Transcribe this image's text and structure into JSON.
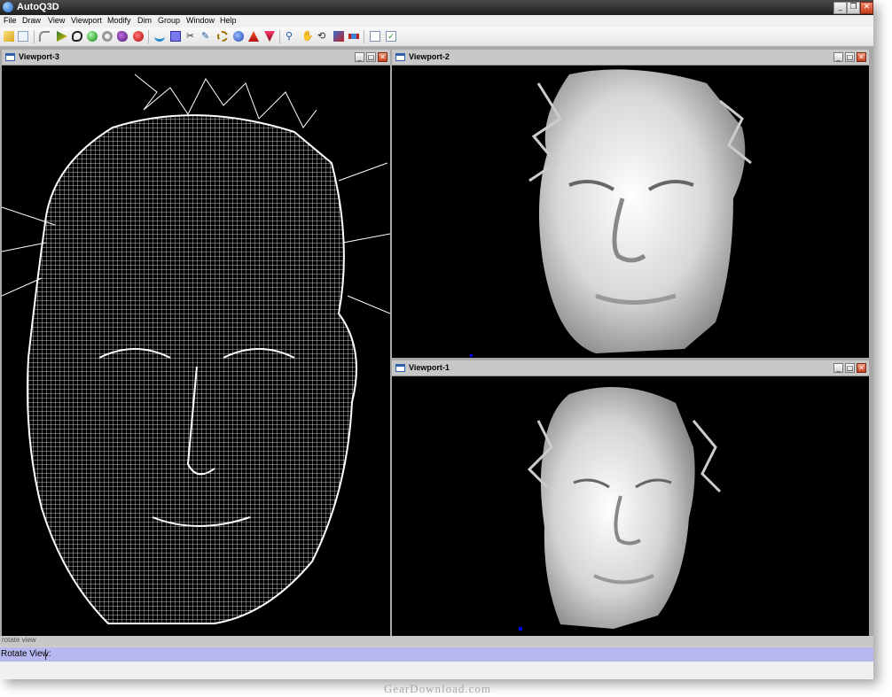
{
  "window": {
    "title": "AutoQ3D"
  },
  "title_buttons": {
    "minimize": "_",
    "restore": "❐",
    "close": "✕"
  },
  "menu": [
    "File",
    "Draw",
    "View",
    "Viewport",
    "Modify",
    "Dim",
    "Group",
    "Window",
    "Help"
  ],
  "toolbar_icons": [
    "new-file-icon",
    "save-icon",
    "curve-icon",
    "pointer-icon",
    "lasso-icon",
    "sphere-green-icon",
    "torus-icon",
    "blob-purple-icon",
    "apple-red-icon",
    "wave-icon",
    "square-blue-icon",
    "scissors-icon",
    "pencil-icon",
    "rotate-chain-icon",
    "fire-icon",
    "sphere-blue-icon",
    "fire2-icon",
    "zoom-icon",
    "hand-pan-icon",
    "rotate-view-icon",
    "cube-icon",
    "bone-icon",
    "document-icon",
    "check-document-icon"
  ],
  "viewports": [
    {
      "name": "Viewport-3",
      "mode": "wireframe"
    },
    {
      "name": "Viewport-2",
      "mode": "shaded"
    },
    {
      "name": "Viewport-1",
      "mode": "shaded"
    }
  ],
  "viewport_buttons": {
    "minimize": "_",
    "maximize": "□",
    "close": "✕"
  },
  "status": {
    "strip_text": "rotate view",
    "command_label": "Rotate View:"
  },
  "watermark": "GearDownload.com",
  "colors": {
    "viewport_bg": "#000000",
    "mesh": "#ffffff",
    "command_bar": "#b8b8f0"
  }
}
